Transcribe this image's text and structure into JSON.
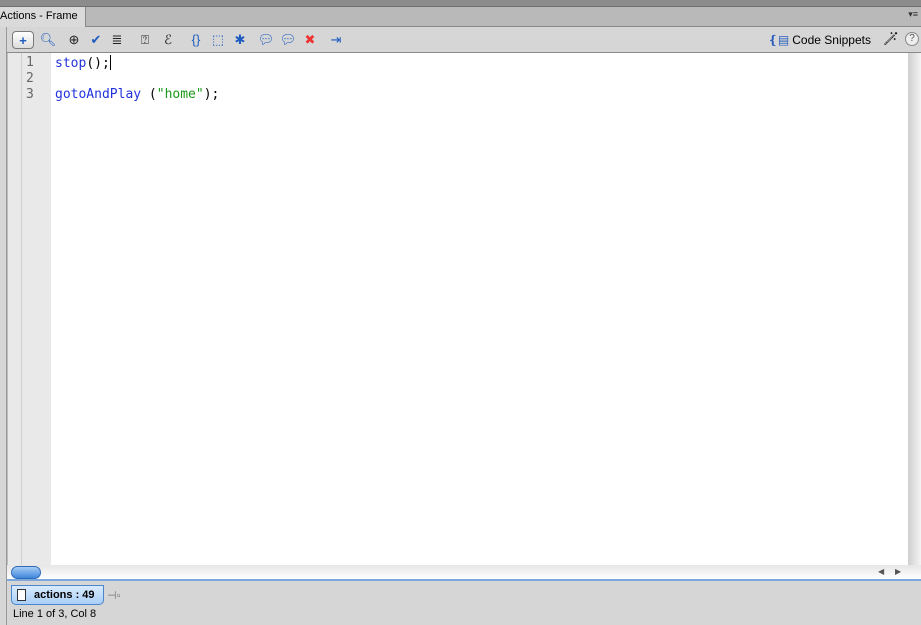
{
  "panel": {
    "title": "Actions - Frame"
  },
  "toolbar": {
    "buttons": [
      "add-new-item",
      "find",
      "insert-target-path",
      "check-syntax",
      "auto-format",
      "show-code-hint",
      "debug-options",
      "collapse-between-braces",
      "collapse-selection",
      "expand-all",
      "apply-block-comment",
      "apply-line-comment",
      "remove-comment",
      "show-hide-toolbox"
    ],
    "code_snippets_label": "Code Snippets",
    "help_label": "?"
  },
  "editor": {
    "line_numbers": [
      "1",
      "2",
      "3"
    ],
    "lines": [
      {
        "tokens": [
          {
            "t": "stop",
            "c": "kw"
          },
          {
            "t": "();",
            "c": "pl"
          }
        ]
      },
      {
        "tokens": []
      },
      {
        "tokens": [
          {
            "t": "gotoAndPlay",
            "c": "kw"
          },
          {
            "t": " (",
            "c": "pl"
          },
          {
            "t": "\"home\"",
            "c": "str"
          },
          {
            "t": ");",
            "c": "pl"
          }
        ]
      }
    ]
  },
  "script_tab": {
    "label": "actions : 49"
  },
  "status": {
    "text": "Line 1 of 3, Col 8"
  },
  "colors": {
    "keyword": "#2233dd",
    "string": "#1a9a1a",
    "accent": "#4c86cc"
  }
}
